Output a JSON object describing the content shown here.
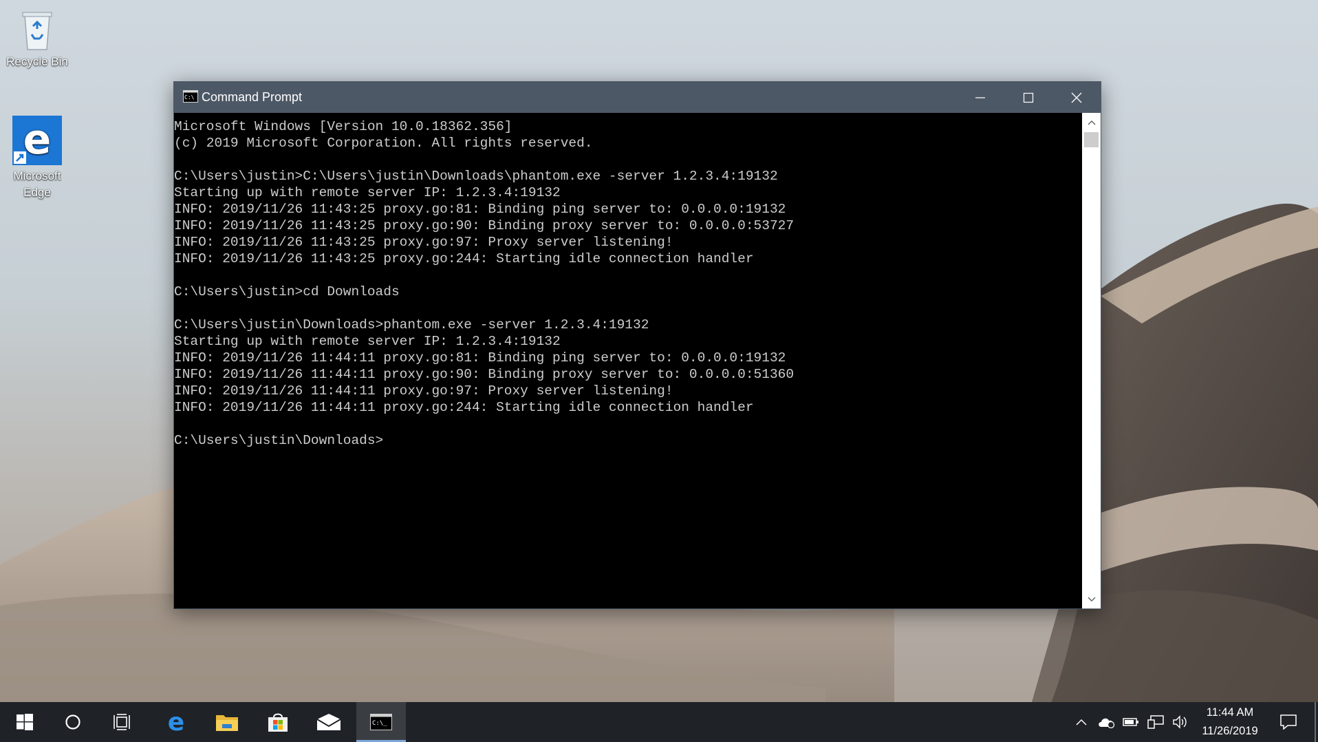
{
  "desktop": {
    "icons": [
      {
        "label": "Recycle Bin",
        "icon": "recycle-bin-icon"
      },
      {
        "label": "Microsoft Edge",
        "icon": "edge-icon"
      }
    ]
  },
  "window": {
    "title": "Command Prompt",
    "icon": "console-icon",
    "buttons": {
      "minimize": "minimize-icon",
      "maximize": "maximize-icon",
      "close": "close-icon"
    }
  },
  "console": {
    "lines": [
      "Microsoft Windows [Version 10.0.18362.356]",
      "(c) 2019 Microsoft Corporation. All rights reserved.",
      "",
      "C:\\Users\\justin>C:\\Users\\justin\\Downloads\\phantom.exe -server 1.2.3.4:19132",
      "Starting up with remote server IP: 1.2.3.4:19132",
      "INFO: 2019/11/26 11:43:25 proxy.go:81: Binding ping server to: 0.0.0.0:19132",
      "INFO: 2019/11/26 11:43:25 proxy.go:90: Binding proxy server to: 0.0.0.0:53727",
      "INFO: 2019/11/26 11:43:25 proxy.go:97: Proxy server listening!",
      "INFO: 2019/11/26 11:43:25 proxy.go:244: Starting idle connection handler",
      "",
      "C:\\Users\\justin>cd Downloads",
      "",
      "C:\\Users\\justin\\Downloads>phantom.exe -server 1.2.3.4:19132",
      "Starting up with remote server IP: 1.2.3.4:19132",
      "INFO: 2019/11/26 11:44:11 proxy.go:81: Binding ping server to: 0.0.0.0:19132",
      "INFO: 2019/11/26 11:44:11 proxy.go:90: Binding proxy server to: 0.0.0.0:51360",
      "INFO: 2019/11/26 11:44:11 proxy.go:97: Proxy server listening!",
      "INFO: 2019/11/26 11:44:11 proxy.go:244: Starting idle connection handler",
      "",
      "C:\\Users\\justin\\Downloads>"
    ]
  },
  "taskbar": {
    "items": [
      "start-icon",
      "search-icon",
      "task-view-icon",
      "edge-icon",
      "file-explorer-icon",
      "store-icon",
      "mail-icon",
      "command-prompt-icon"
    ],
    "tray": [
      "chevron-up-icon",
      "onedrive-icon",
      "battery-icon",
      "network-icon",
      "volume-icon"
    ],
    "clock": {
      "time": "11:44 AM",
      "date": "11/26/2019"
    }
  },
  "colors": {
    "titlebar": "#4d5866",
    "console_bg": "#000000",
    "console_text": "#cccccc",
    "taskbar": "#1f2227",
    "accent": "#0078d7"
  }
}
